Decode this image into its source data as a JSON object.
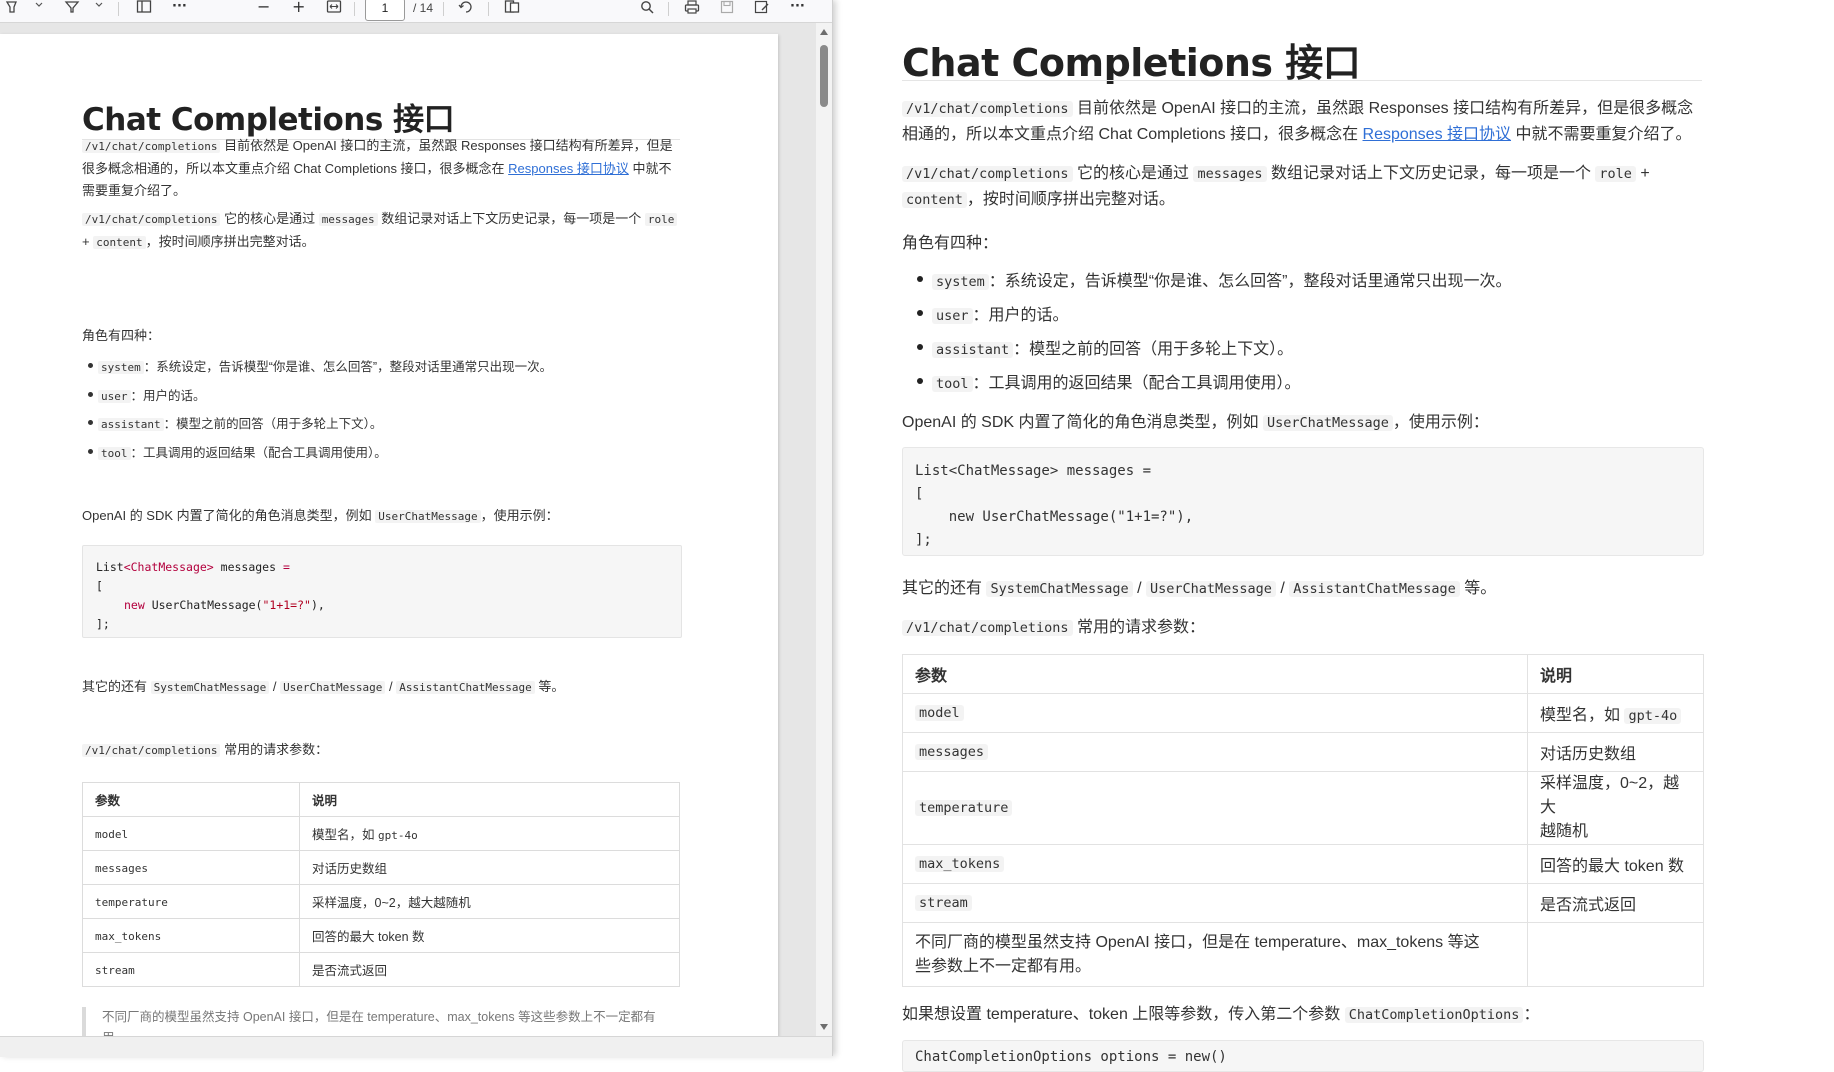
{
  "toolbar": {
    "page_number": "1",
    "page_count": "/ 14",
    "zoom_out": "−",
    "zoom_in": "+",
    "more": "···"
  },
  "doc": {
    "title": "Chat Completions 接口",
    "intro_code": "/v1/chat/completions",
    "intro_text_1": " 目前依然是 OpenAI 接口的主流，虽然跟 Responses 接口结构有所差异，但是很多概念相通的，所以本文重点介绍 Chat Completions 接口，很多概念在 ",
    "intro_link": "Responses 接口协议",
    "intro_text_2": " 中就不需要重复介绍了。",
    "core_code": "/v1/chat/completions",
    "core_text_1": " 它的核心是通过 ",
    "core_messages": "messages",
    "core_text_2": " 数组记录对话上下文历史记录，每一项是一个 ",
    "core_role": "role",
    "core_plus": " + ",
    "core_content": "content",
    "core_text_3": "，按时间顺序拼出完整对话。",
    "roles_heading": "角色有四种：",
    "roles": [
      {
        "code": "system",
        "text": "：系统设定，告诉模型“你是谁、怎么回答”，整段对话里通常只出现一次。"
      },
      {
        "code": "user",
        "text": "：用户的话。"
      },
      {
        "code": "assistant",
        "text": "：模型之前的回答（用于多轮上下文）。"
      },
      {
        "code": "tool",
        "text": "：工具调用的返回结果（配合工具调用使用）。"
      }
    ],
    "sdk_text_1": "OpenAI 的 SDK 内置了简化的角色消息类型，例如 ",
    "sdk_code": "UserChatMessage",
    "sdk_text_2": "，使用示例：",
    "code_lines": [
      "List<ChatMessage> messages =",
      "[",
      "    new UserChatMessage(\"1+1=?\"),",
      "];"
    ],
    "code_pdf": {
      "l1_a": "List",
      "l1_b": "<ChatMessage>",
      "l1_c": " messages ",
      "l1_d": "=",
      "l2": "[",
      "l3_kw": "new",
      "l3_a": " UserChatMessage(",
      "l3_str": "\"1+1=?\"",
      "l3_b": "),",
      "l4": "];"
    },
    "others_text_1": "其它的还有 ",
    "others_c1": "SystemChatMessage",
    "others_sep": " / ",
    "others_c2": "UserChatMessage",
    "others_c3": "AssistantChatMessage",
    "others_text_2": " 等。",
    "params_code": "/v1/chat/completions",
    "params_text": " 常用的请求参数：",
    "table": {
      "headers": [
        "参数",
        "说明"
      ],
      "rows": [
        {
          "param": "model",
          "desc": "模型名，如 ",
          "desc_code": "gpt-4o"
        },
        {
          "param": "messages",
          "desc": "对话历史数组",
          "desc_code": ""
        },
        {
          "param": "temperature",
          "desc": "采样温度，0~2，越大越随机",
          "desc_code": ""
        },
        {
          "param": "max_tokens",
          "desc": "回答的最大 token 数",
          "desc_code": ""
        },
        {
          "param": "stream",
          "desc": "是否流式返回",
          "desc_code": ""
        }
      ],
      "note": "不同厂商的模型虽然支持 OpenAI 接口，但是在 temperature、max_tokens 等这些参数上不一定都有用。"
    },
    "right_temp_desc_1": "采样温度，0~2，越大",
    "right_temp_desc_2": "越随机",
    "right_note_1": "不同厂商的模型虽然支持 OpenAI 接口，但是在 temperature、max_tokens 等这",
    "right_note_2": "些参数上不一定都有用。",
    "options_text_1": "如果想设置 temperature、token 上限等参数，传入第二个参数 ",
    "options_code": "ChatCompletionOptions",
    "options_text_2": "：",
    "options_code_peek": "ChatCompletionOptions options = new()"
  }
}
